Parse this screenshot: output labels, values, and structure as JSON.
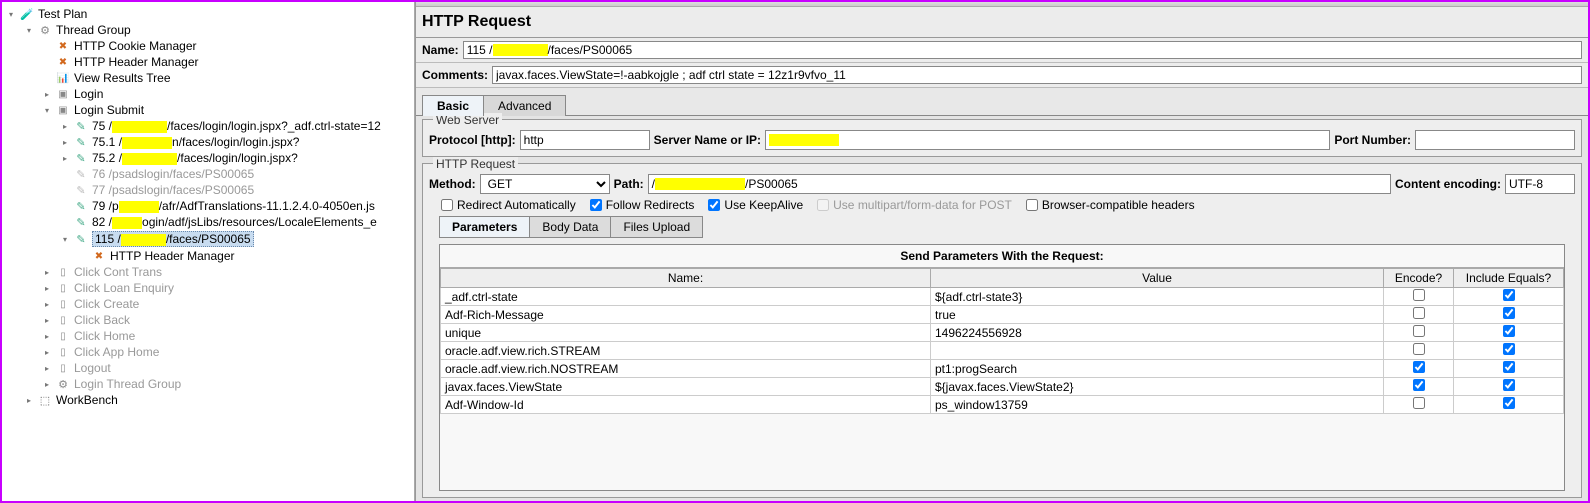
{
  "tree": {
    "root": "Test Plan",
    "thread_group": "Thread Group",
    "cookie_mgr": "HTTP Cookie Manager",
    "header_mgr": "HTTP Header Manager",
    "view_results": "View Results Tree",
    "login": "Login",
    "login_submit": "Login Submit",
    "req75_pre": "75 /",
    "req75_post": "/faces/login/login.jspx?_adf.ctrl-state=12",
    "req75_1_pre": "75.1 /",
    "req75_1_post": "n/faces/login/login.jspx?",
    "req75_2_pre": "75.2 /",
    "req75_2_post": "/faces/login/login.jspx?",
    "req76": "76 /psadslogin/faces/PS00065",
    "req77": "77 /psadslogin/faces/PS00065",
    "req79_pre": "79 /p",
    "req79_post": "/afr/AdfTranslations-11.1.2.4.0-4050en.js",
    "req82_pre": "82 /",
    "req82_post": "ogin/adf/jsLibs/resources/LocaleElements_e",
    "req115_pre": "115 /",
    "req115_post": "/faces/PS00065",
    "sub_header_mgr": "HTTP Header Manager",
    "click_cont": "Click Cont Trans",
    "click_loan": "Click Loan Enquiry",
    "click_create": "Click Create",
    "click_back": "Click Back",
    "click_home": "Click Home",
    "click_app_home": "Click App Home",
    "logout": "Logout",
    "login_thread": "Login Thread Group",
    "workbench": "WorkBench"
  },
  "main": {
    "title": "HTTP Request",
    "name_label": "Name:",
    "name_value_pre": "115 /",
    "name_value_post": "/faces/PS00065",
    "comments_label": "Comments:",
    "comments_value": "javax.faces.ViewState=!-aabkojgle ; adf ctrl state = 12z1r9vfvo_11",
    "tab_basic": "Basic",
    "tab_advanced": "Advanced",
    "webserver_legend": "Web Server",
    "protocol_label": "Protocol [http]:",
    "protocol_value": "http",
    "server_label": "Server Name or IP:",
    "port_label": "Port Number:",
    "httprequest_legend": "HTTP Request",
    "method_label": "Method:",
    "method_value": "GET",
    "path_label": "Path:",
    "path_value_post": "/PS00065",
    "encoding_label": "Content encoding:",
    "encoding_value": "UTF-8",
    "chk_redirect_auto": "Redirect Automatically",
    "chk_follow_redirects": "Follow Redirects",
    "chk_keepalive": "Use KeepAlive",
    "chk_multipart": "Use multipart/form-data for POST",
    "chk_browser_compat": "Browser-compatible headers",
    "subtab_params": "Parameters",
    "subtab_body": "Body Data",
    "subtab_files": "Files Upload",
    "params_title": "Send Parameters With the Request:",
    "col_name": "Name:",
    "col_value": "Value",
    "col_encode": "Encode?",
    "col_equals": "Include Equals?",
    "rows": [
      {
        "name": "_adf.ctrl-state",
        "value": "${adf.ctrl-state3}",
        "encode": false,
        "equals": true
      },
      {
        "name": "Adf-Rich-Message",
        "value": "true",
        "encode": false,
        "equals": true
      },
      {
        "name": "unique",
        "value": "1496224556928",
        "encode": false,
        "equals": true
      },
      {
        "name": "oracle.adf.view.rich.STREAM",
        "value": "",
        "encode": false,
        "equals": true
      },
      {
        "name": "oracle.adf.view.rich.NOSTREAM",
        "value": "pt1:progSearch",
        "encode": true,
        "equals": true
      },
      {
        "name": "javax.faces.ViewState",
        "value": "${javax.faces.ViewState2}",
        "encode": true,
        "equals": true
      },
      {
        "name": "Adf-Window-Id",
        "value": "ps_window13759",
        "encode": false,
        "equals": true
      }
    ]
  }
}
